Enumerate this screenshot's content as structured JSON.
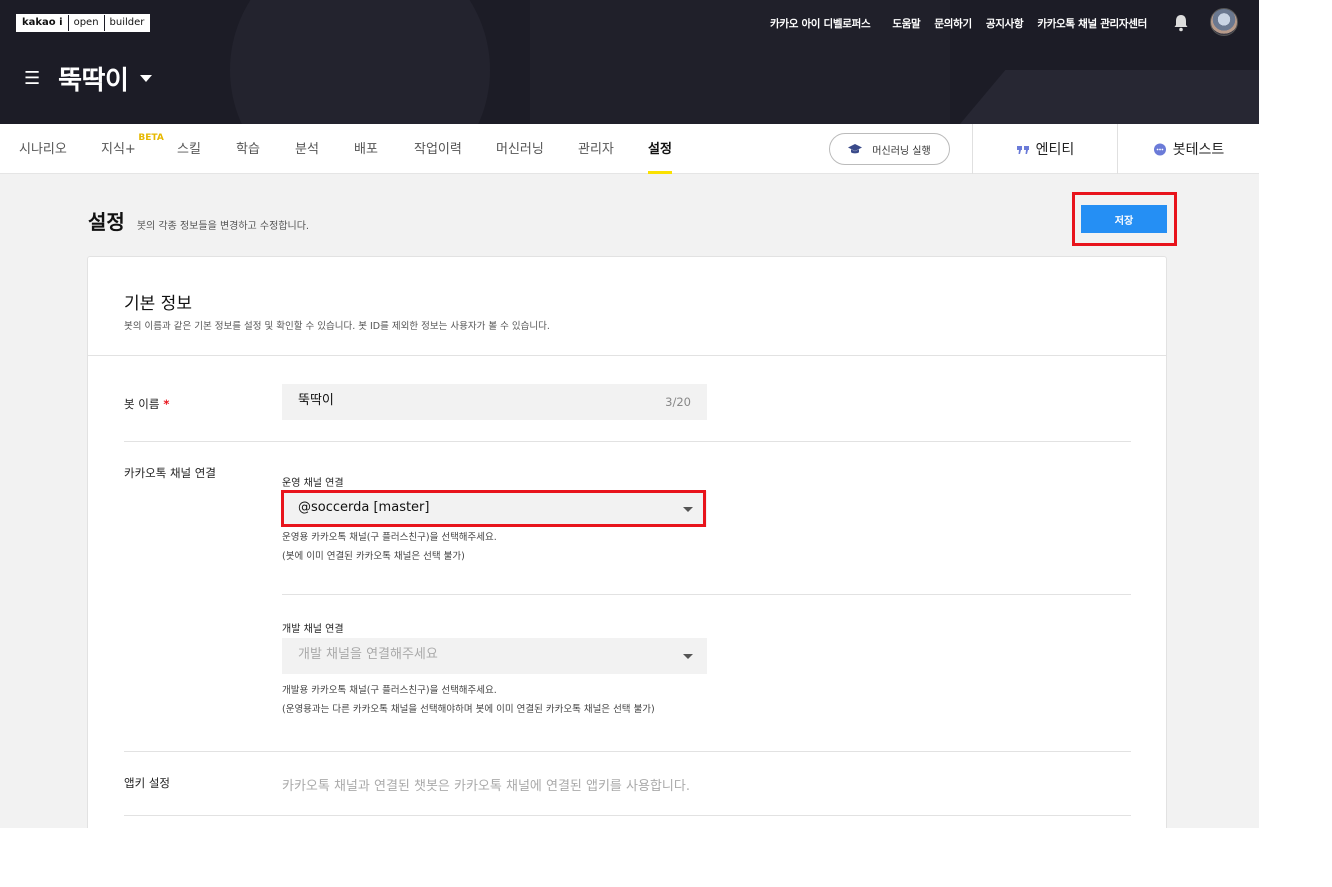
{
  "header": {
    "logo": [
      "kakao i",
      "open",
      "builder"
    ],
    "links": [
      "카카오 아이 디벨로퍼스",
      "도움말",
      "문의하기",
      "공지사항",
      "카카오톡 채널 관리자센터"
    ],
    "bot_name": "뚝딱이"
  },
  "nav": {
    "tabs": [
      "시나리오",
      "지식+",
      "스킬",
      "학습",
      "분석",
      "배포",
      "작업이력",
      "머신러닝",
      "관리자",
      "설정"
    ],
    "beta_badge": "BETA",
    "active_tab": "설정",
    "ml_button": "머신러닝 실행",
    "entity": "엔티티",
    "bot_test": "봇테스트"
  },
  "page": {
    "title": "설정",
    "subtitle": "봇의 각종 정보들을 변경하고 수정합니다.",
    "save_label": "저장"
  },
  "basic_info": {
    "title": "기본 정보",
    "description": "봇의 이름과 같은 기본 정보를 설정 및 확인할 수 있습니다. 봇 ID를 제외한 정보는 사용자가 볼 수 있습니다.",
    "bot_name_label": "봇 이름",
    "bot_name_required": "*",
    "bot_name_value": "뚝딱이",
    "bot_name_count": "3/20",
    "channel_label": "카카오톡 채널 연결",
    "prod_channel_label": "운영 채널 연결",
    "prod_channel_value": "@soccerda [master]",
    "prod_help_1": "운영용 카카오톡 채널(구 플러스친구)을 선택해주세요.",
    "prod_help_2": "(봇에 이미 연결된 카카오톡 채널은 선택 불가)",
    "dev_channel_label": "개발 채널 연결",
    "dev_channel_placeholder": "개발 채널을 연결해주세요",
    "dev_help_1": "개발용 카카오톡 채널(구 플러스친구)을 선택해주세요.",
    "dev_help_2": "(운영용과는 다른 카카오톡 채널을 선택해야하며 봇에 이미 연결된 카카오톡 채널은 선택 불가)",
    "appkey_label": "앱키 설정",
    "appkey_text": "카카오톡 채널과 연결된 챗봇은 카카오톡 채널에 연결된 앱키를 사용합니다."
  },
  "colors": {
    "accent_yellow": "#fae100",
    "primary_blue": "#258ff4",
    "highlight_red": "#e8141c",
    "header_dark": "#1c1c26"
  }
}
